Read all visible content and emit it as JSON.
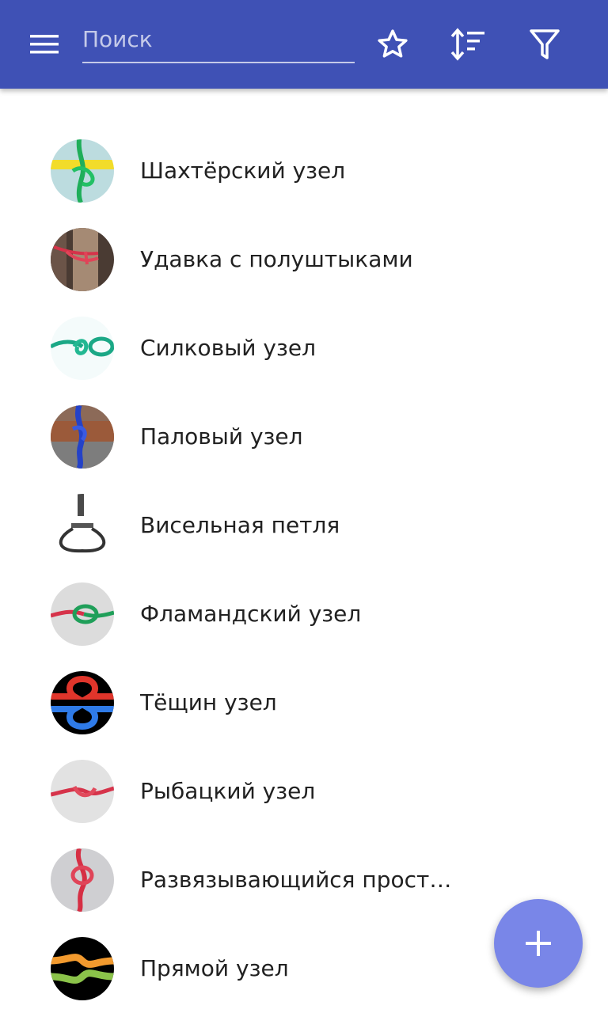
{
  "toolbar": {
    "search_placeholder": "Поиск",
    "background_color": "#3f51b5",
    "icons": [
      "menu-icon",
      "star-icon",
      "sort-icon",
      "filter-icon"
    ]
  },
  "knots": [
    {
      "title": "Шахтёрский узел",
      "thumb_icon": "miner-knot-thumbnail"
    },
    {
      "title": "Удавка с полуштыками",
      "thumb_icon": "timber-hitch-thumbnail"
    },
    {
      "title": "Силковый узел",
      "thumb_icon": "snare-knot-thumbnail"
    },
    {
      "title": "Паловый узел",
      "thumb_icon": "pile-hitch-thumbnail"
    },
    {
      "title": "Висельная петля",
      "thumb_icon": "hangman-noose-thumbnail"
    },
    {
      "title": "Фламандский узел",
      "thumb_icon": "flemish-knot-thumbnail"
    },
    {
      "title": "Тёщин узел",
      "thumb_icon": "thief-knot-thumbnail"
    },
    {
      "title": "Рыбацкий узел",
      "thumb_icon": "fisherman-knot-thumbnail"
    },
    {
      "title": "Развязывающийся простой узел",
      "thumb_icon": "slipped-overhand-thumbnail"
    },
    {
      "title": "Прямой узел",
      "thumb_icon": "square-knot-thumbnail"
    }
  ],
  "fab": {
    "icon": "plus-icon",
    "color": "#7986e8"
  }
}
